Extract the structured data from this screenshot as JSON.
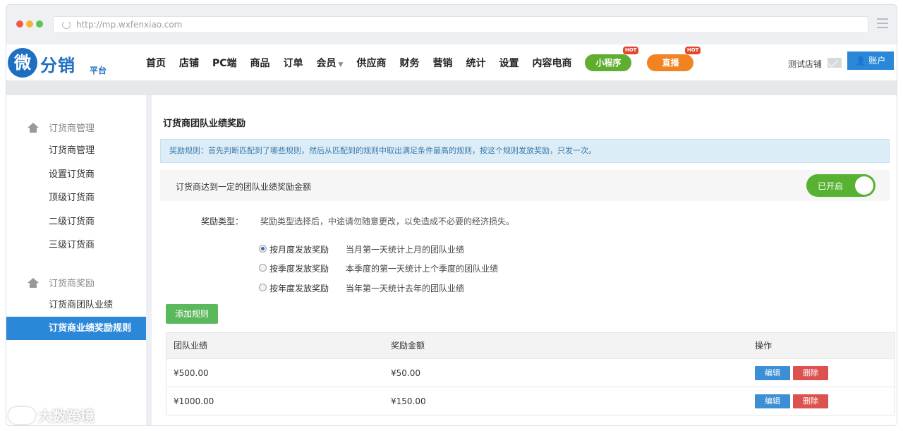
{
  "browser": {
    "url": "http://mp.wxfenxiao.com"
  },
  "header": {
    "logo_mark": "微",
    "logo_text": "分销",
    "logo_sub": "平台",
    "nav": [
      {
        "label": "首页"
      },
      {
        "label": "店铺"
      },
      {
        "label": "PC端"
      },
      {
        "label": "商品"
      },
      {
        "label": "订单"
      },
      {
        "label": "会员"
      },
      {
        "label": "供应商"
      },
      {
        "label": "财务"
      },
      {
        "label": "营销"
      },
      {
        "label": "统计"
      },
      {
        "label": "设置"
      },
      {
        "label": "内容电商"
      }
    ],
    "pill_miniapp": "小程序",
    "pill_live": "直播",
    "hot_badge": "HOT",
    "store_name": "测试店铺",
    "account_label": "账户",
    "colors": {
      "brand": "#1e6fc1",
      "miniapp": "#5fae2f",
      "live": "#f18322",
      "account": "#2b88d9"
    }
  },
  "sidebar": {
    "group1": "订货商管理",
    "items1": [
      {
        "label": "订货商管理"
      },
      {
        "label": "设置订货商"
      },
      {
        "label": "顶级订货商"
      },
      {
        "label": "二级订货商"
      },
      {
        "label": "三级订货商"
      }
    ],
    "group2": "订货商奖励",
    "items2": [
      {
        "label": "订货商团队业绩"
      },
      {
        "label": "订货商业绩奖励规则",
        "active": true
      }
    ]
  },
  "main": {
    "title": "订货商团队业绩奖励",
    "notice": "奖励规则：首先判断匹配到了哪些规则，然后从匹配到的规则中取出满足条件最高的规则，按这个规则发放奖励，只发一次。",
    "toggle_label": "订货商达到一定的团队业绩奖励金额",
    "toggle_state": "已开启",
    "reward_type_label": "奖励类型：",
    "reward_type_hint": "奖励类型选择后，中途请勿随意更改，以免造成不必要的经济损失。",
    "options": [
      {
        "label": "按月度发放奖励",
        "desc": "当月第一天统计上月的团队业绩",
        "checked": true
      },
      {
        "label": "按季度发放奖励",
        "desc": "本季度的第一天统计上个季度的团队业绩",
        "checked": false
      },
      {
        "label": "按年度发放奖励",
        "desc": "当年第一天统计去年的团队业绩",
        "checked": false
      }
    ],
    "add_rule": "添加规则",
    "table": {
      "headers": [
        "团队业绩",
        "奖励金额",
        "操作"
      ],
      "rows": [
        {
          "performance": "¥500.00",
          "reward": "¥50.00"
        },
        {
          "performance": "¥1000.00",
          "reward": "¥150.00"
        }
      ],
      "edit": "编辑",
      "delete": "删除"
    }
  },
  "watermark": "大数跨境"
}
